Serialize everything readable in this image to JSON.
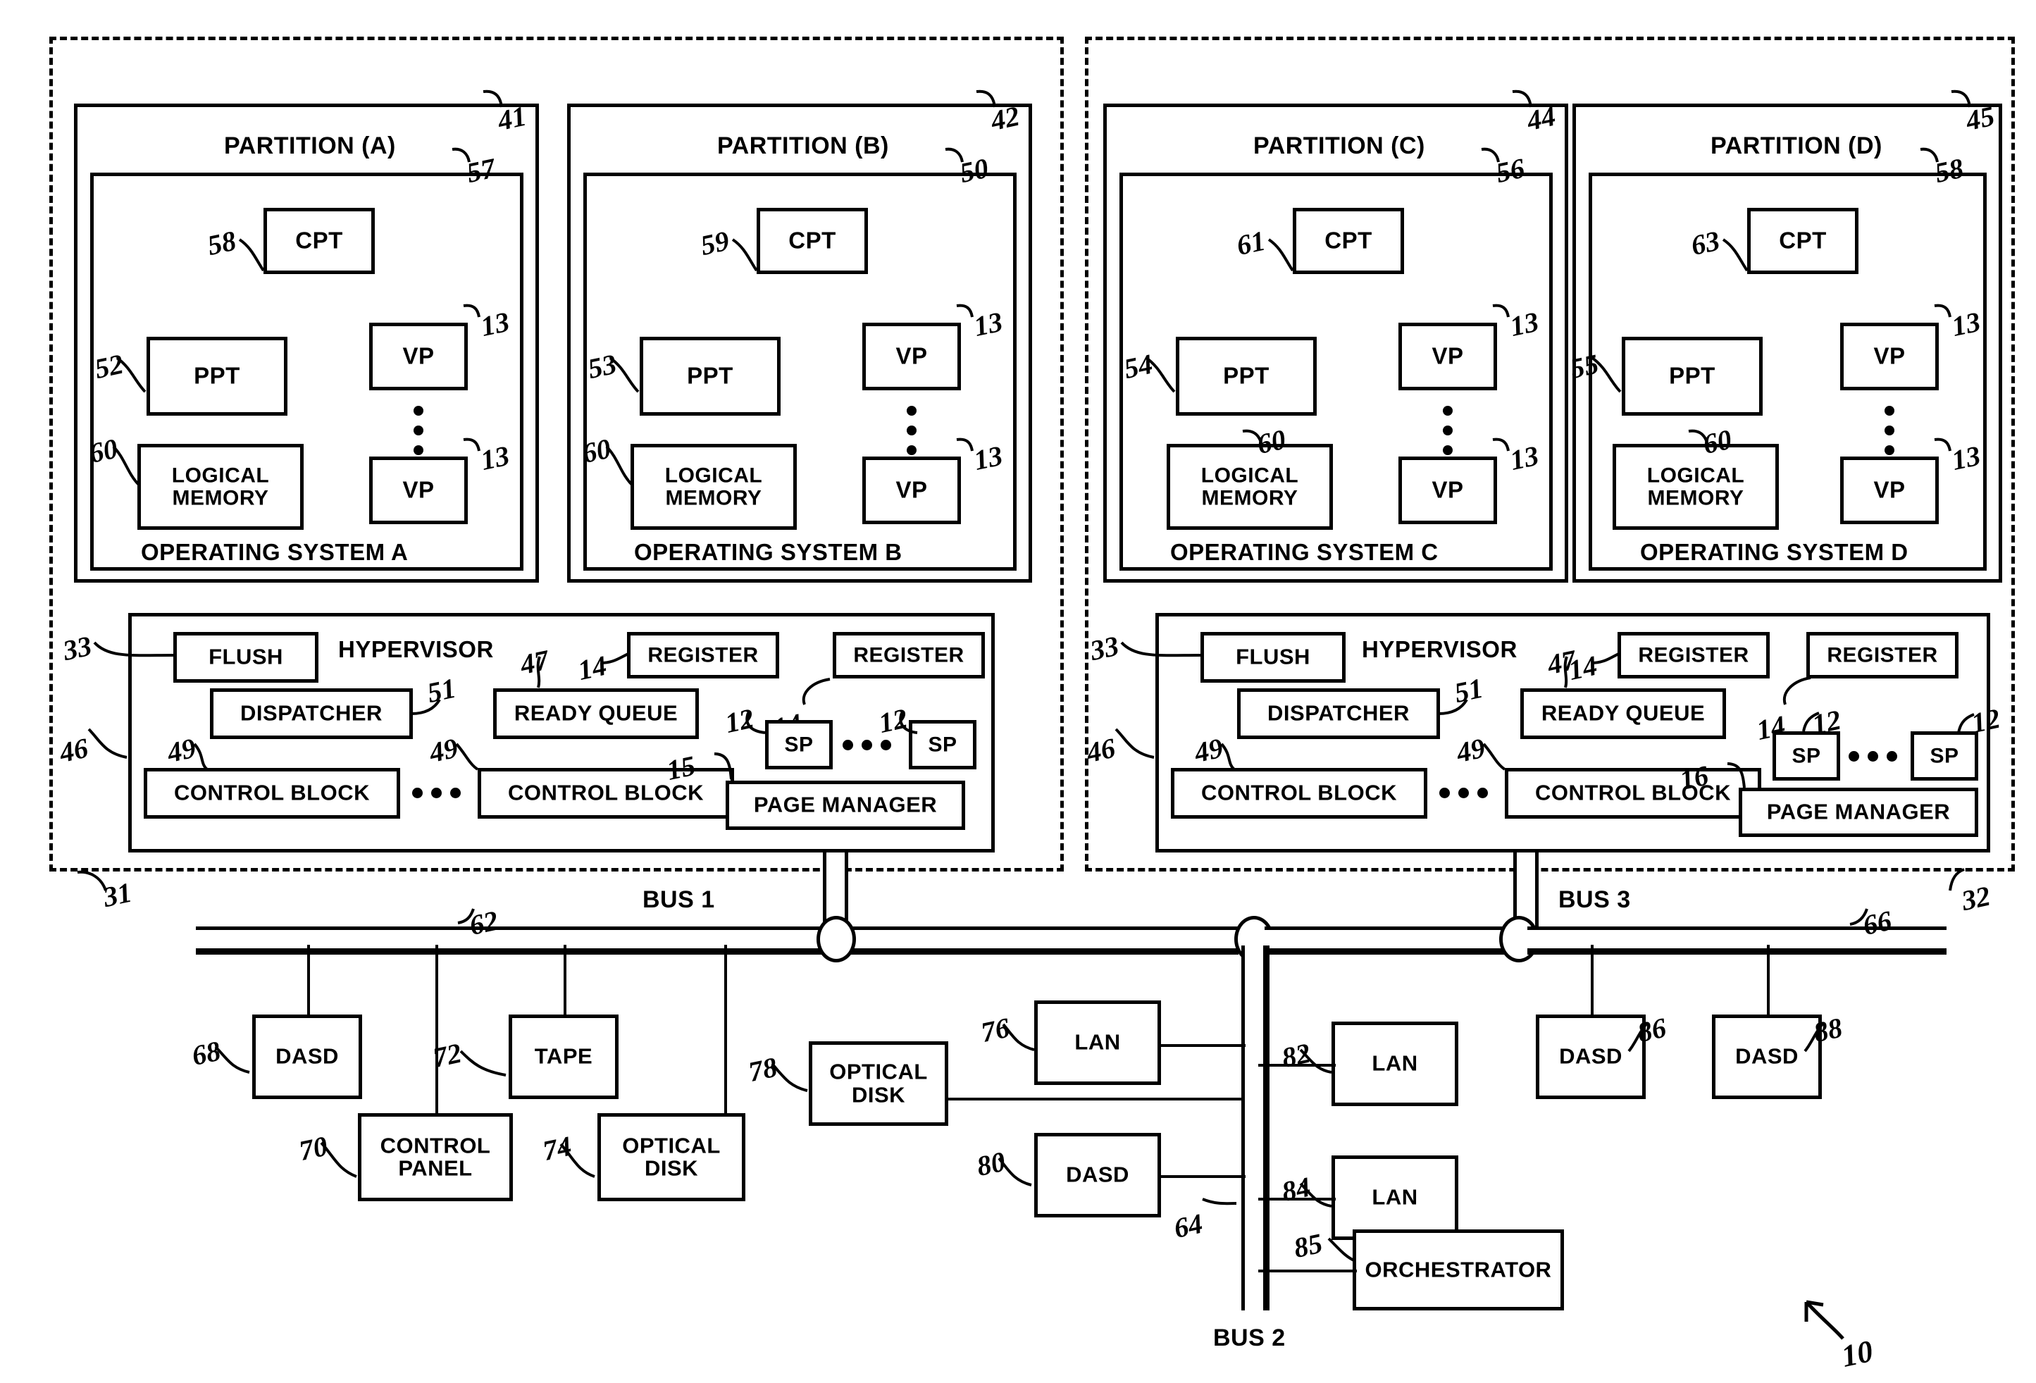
{
  "figure": {
    "ref_10": "10",
    "left_system_ref": "31",
    "right_system_ref": "32"
  },
  "partitions": [
    {
      "title": "PARTITION (A)",
      "partition_ref": "41",
      "os_box_ref": "57",
      "cpt_label": "CPT",
      "cpt_ref": "58",
      "ppt_label": "PPT",
      "ppt_ref": "52",
      "logical_memory_label": "LOGICAL\nMEMORY",
      "logical_memory_ref": "60",
      "vp_label": "VP",
      "vp_top_ref": "13",
      "vp_bottom_ref": "13",
      "os_label": "OPERATING SYSTEM A"
    },
    {
      "title": "PARTITION (B)",
      "partition_ref": "42",
      "os_box_ref": "50",
      "cpt_label": "CPT",
      "cpt_ref": "59",
      "ppt_label": "PPT",
      "ppt_ref": "53",
      "logical_memory_label": "LOGICAL\nMEMORY",
      "logical_memory_ref": "60",
      "vp_label": "VP",
      "vp_top_ref": "13",
      "vp_bottom_ref": "13",
      "os_label": "OPERATING SYSTEM B"
    },
    {
      "title": "PARTITION (C)",
      "partition_ref": "44",
      "os_box_ref": "56",
      "cpt_label": "CPT",
      "cpt_ref": "61",
      "ppt_label": "PPT",
      "ppt_ref": "54",
      "logical_memory_label": "LOGICAL\nMEMORY",
      "logical_memory_ref": "60",
      "vp_label": "VP",
      "vp_top_ref": "13",
      "vp_bottom_ref": "13",
      "os_label": "OPERATING SYSTEM C"
    },
    {
      "title": "PARTITION (D)",
      "partition_ref": "45",
      "os_box_ref": "58",
      "cpt_label": "CPT",
      "cpt_ref": "63",
      "ppt_label": "PPT",
      "ppt_ref": "55",
      "logical_memory_label": "LOGICAL\nMEMORY",
      "logical_memory_ref": "60",
      "vp_label": "VP",
      "vp_top_ref": "13",
      "vp_bottom_ref": "13",
      "os_label": "OPERATING SYSTEM D"
    }
  ],
  "hypervisors": [
    {
      "title": "HYPERVISOR",
      "hypervisor_ref": "46",
      "flush_label": "FLUSH",
      "flush_ref": "33",
      "dispatcher_label": "DISPATCHER",
      "dispatcher_ref": "51",
      "control_block_label": "CONTROL BLOCK",
      "control_block_ref_left": "49",
      "control_block_ref_right": "49",
      "ready_queue_label": "READY QUEUE",
      "ready_queue_ref": "47",
      "register_label": "REGISTER",
      "register_ref_left": "14",
      "register_ref_right": "14",
      "sp_label": "SP",
      "sp_ref_left": "12",
      "sp_ref_right": "12",
      "page_manager_label": "PAGE MANAGER",
      "page_manager_ref": "15"
    },
    {
      "title": "HYPERVISOR",
      "hypervisor_ref": "46",
      "flush_label": "FLUSH",
      "flush_ref": "33",
      "dispatcher_label": "DISPATCHER",
      "dispatcher_ref": "51",
      "control_block_label": "CONTROL BLOCK",
      "control_block_ref_left": "49",
      "control_block_ref_right": "49",
      "ready_queue_label": "READY QUEUE",
      "ready_queue_ref": "47",
      "register_label": "REGISTER",
      "register_ref_left": "14",
      "register_ref_right": "14",
      "sp_label": "SP",
      "sp_ref_left": "12",
      "sp_ref_right": "12",
      "page_manager_label": "PAGE MANAGER",
      "page_manager_ref": "16"
    }
  ],
  "buses": {
    "bus1_label": "BUS 1",
    "bus1_ref": "62",
    "bus2_label": "BUS 2",
    "bus2_ref": "64",
    "bus3_label": "BUS 3",
    "bus3_ref": "66"
  },
  "devices": [
    {
      "label": "DASD",
      "ref": "68"
    },
    {
      "label": "CONTROL\nPANEL",
      "ref": "70"
    },
    {
      "label": "TAPE",
      "ref": "72"
    },
    {
      "label": "OPTICAL\nDISK",
      "ref": "74"
    },
    {
      "label": "LAN",
      "ref": "76"
    },
    {
      "label": "OPTICAL\nDISK",
      "ref": "78"
    },
    {
      "label": "DASD",
      "ref": "80"
    },
    {
      "label": "LAN",
      "ref": "82"
    },
    {
      "label": "LAN",
      "ref": "84"
    },
    {
      "label": "ORCHESTRATOR",
      "ref": "85"
    },
    {
      "label": "DASD",
      "ref": "86"
    },
    {
      "label": "DASD",
      "ref": "88"
    }
  ]
}
